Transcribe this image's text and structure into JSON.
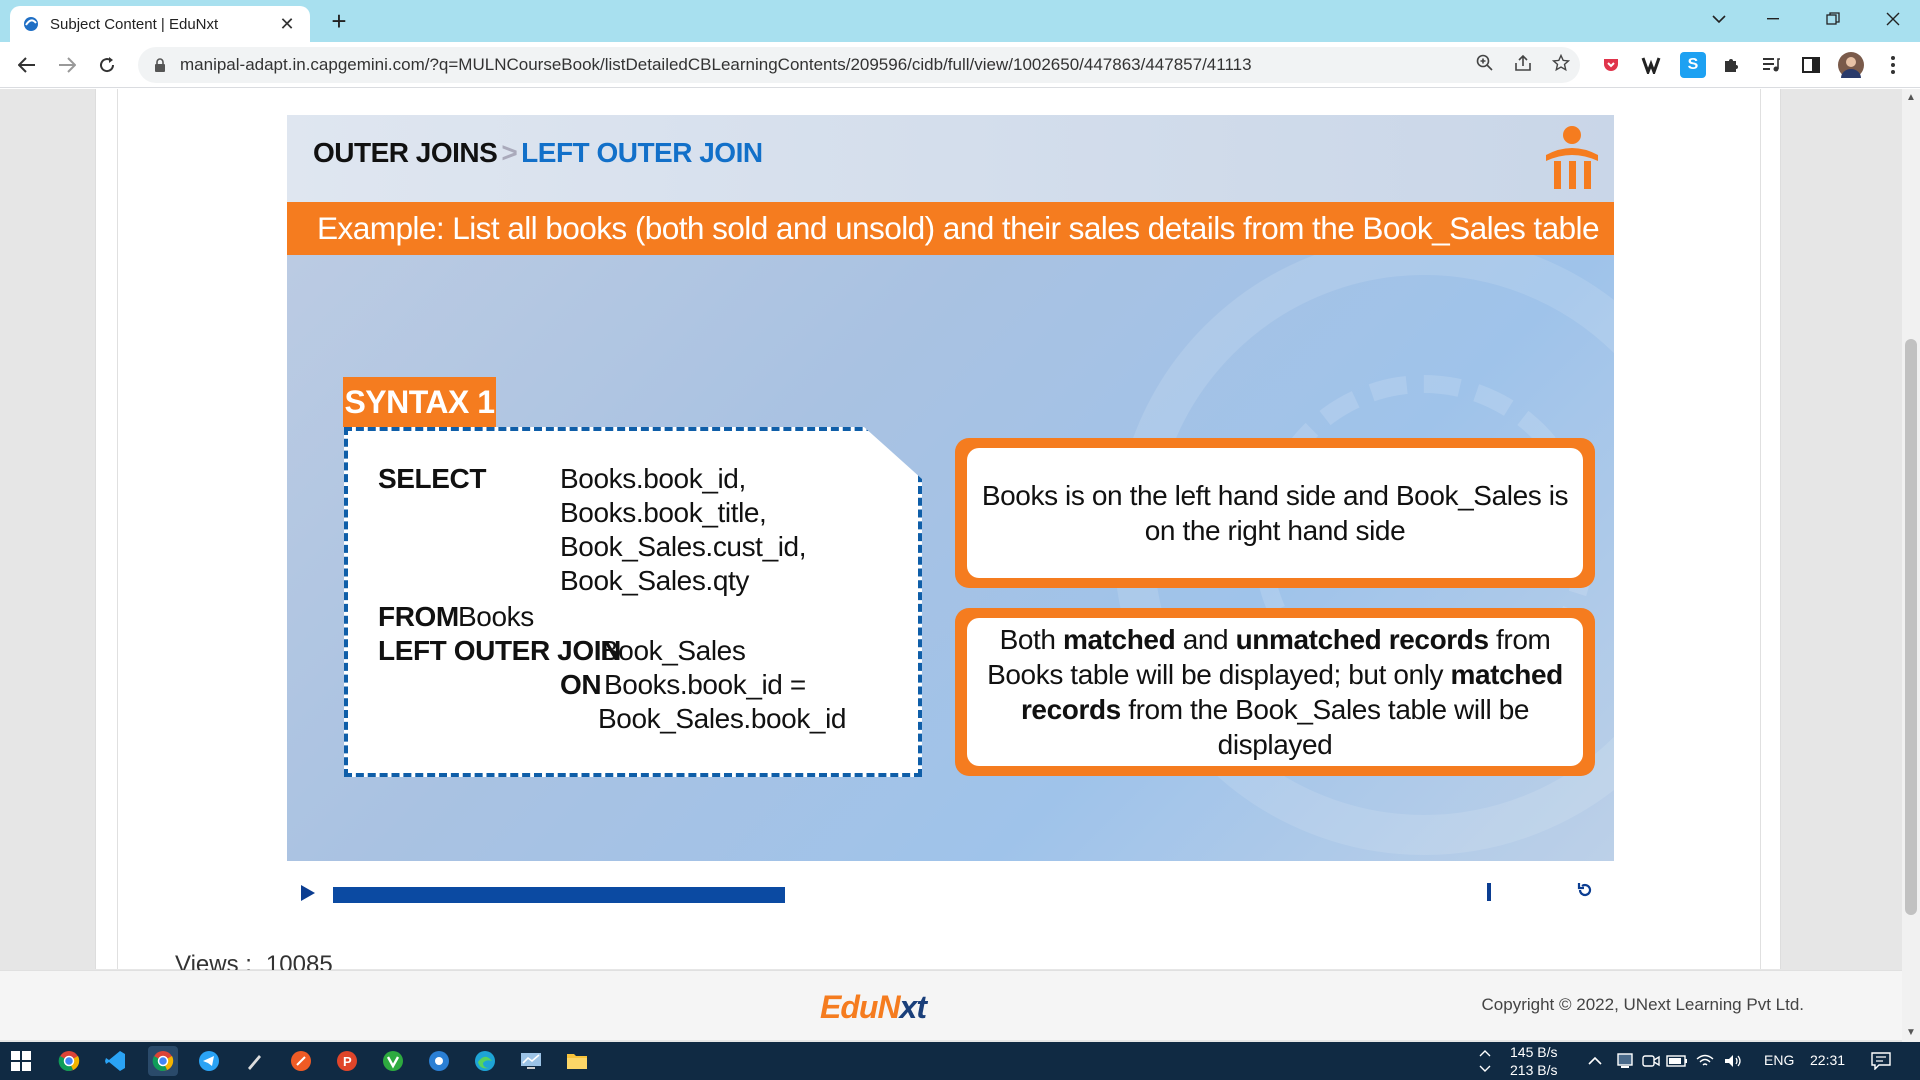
{
  "browser": {
    "tab_title": "Subject Content | EduNxt",
    "tab_close": "✕",
    "new_tab": "+",
    "url": "manipal-adapt.in.capgemini.com/?q=MULNCourseBook/listDetailedCBLearningContents/209596/cidb/full/view/1002650/447863/447857/41113"
  },
  "slide": {
    "breadcrumb_parent": "OUTER JOINS",
    "breadcrumb_sep": ">",
    "breadcrumb_current": "LEFT OUTER JOIN",
    "example": "Example: List all books (both sold and unsold) and their sales details from the Book_Sales table",
    "syntax_label": "SYNTAX 1",
    "code": {
      "select_kw": "SELECT",
      "col1": "Books.book_id,",
      "col2": "Books.book_title,",
      "col3": "Book_Sales.cust_id,",
      "col4": "Book_Sales.qty",
      "from_kw": "FROM",
      "from_table": "Books",
      "join_kw": "LEFT OUTER JOIN",
      "join_table": "Book_Sales",
      "on_kw": "ON",
      "on_cond1": "Books.book_id =",
      "on_cond2": "Book_Sales.book_id"
    },
    "note1": "Books is on the left hand side and Book_Sales is on the right hand side",
    "note2": {
      "p1": "Both ",
      "b1": "matched",
      "p2": " and ",
      "b2": "unmatched records",
      "p3": " from Books table will be displayed; but only ",
      "b3": "matched records",
      "p4": " from the Book_Sales table will be displayed"
    }
  },
  "player": {
    "progress_fraction": 0.39
  },
  "views": {
    "label": "Views :",
    "count": "10085"
  },
  "footer": {
    "brand_a": "EduN",
    "brand_b": "xt",
    "copyright": "Copyright © 2022, UNext Learning Pvt Ltd."
  },
  "taskbar": {
    "net_up": "145 B/s",
    "net_down": "213 B/s",
    "lang": "ENG",
    "time": "22:31"
  },
  "colors": {
    "accent_orange": "#f57c1f",
    "accent_blue": "#1270c9",
    "chrome_title": "#a8e0ef",
    "taskbar": "#102a43"
  }
}
